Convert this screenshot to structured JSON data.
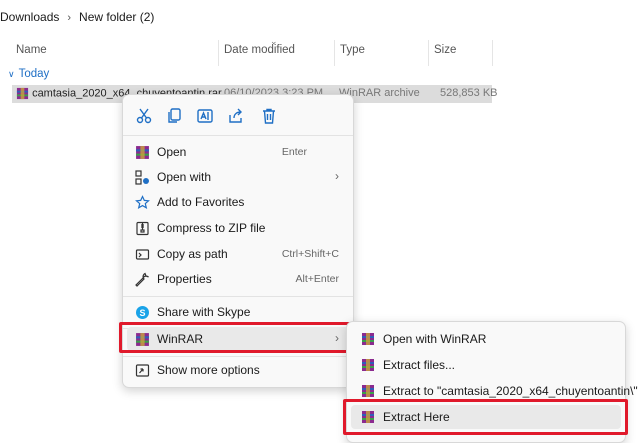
{
  "breadcrumb": {
    "items": [
      "Downloads",
      "New folder (2)"
    ],
    "separator": "›"
  },
  "columns": {
    "name": "Name",
    "date": "Date modified",
    "type": "Type",
    "size": "Size"
  },
  "group": {
    "label": "Today"
  },
  "file": {
    "name": "camtasia_2020_x64_chuyentoantin.rar",
    "date": "06/10/2023 3:23 PM",
    "type": "WinRAR archive",
    "size": "528,853 KB"
  },
  "quick_actions": [
    "cut-icon",
    "copy-icon",
    "rename-icon",
    "share-icon",
    "delete-icon"
  ],
  "context_menu": {
    "open": {
      "label": "Open",
      "shortcut": "Enter"
    },
    "open_with": {
      "label": "Open with"
    },
    "favorites": {
      "label": "Add to Favorites"
    },
    "compress": {
      "label": "Compress to ZIP file"
    },
    "copy_path": {
      "label": "Copy as path",
      "shortcut": "Ctrl+Shift+C"
    },
    "properties": {
      "label": "Properties",
      "shortcut": "Alt+Enter"
    },
    "skype": {
      "label": "Share with Skype"
    },
    "winrar": {
      "label": "WinRAR"
    },
    "more": {
      "label": "Show more options"
    }
  },
  "winrar_submenu": {
    "open_with": "Open with WinRAR",
    "extract_files": "Extract files...",
    "extract_to": "Extract to \"camtasia_2020_x64_chuyentoantin\\\"",
    "extract_here": "Extract Here"
  },
  "colors": {
    "accent": "#1f6fc5",
    "highlight_box": "#e0192b",
    "selection": "#dcdcdc"
  }
}
